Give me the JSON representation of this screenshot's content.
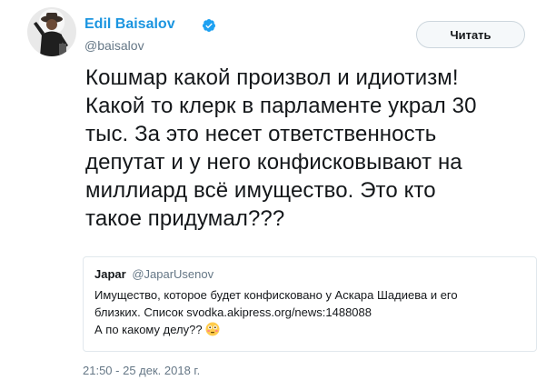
{
  "author": {
    "name": "Edil Baisalov",
    "handle": "@baisalov",
    "verified": true
  },
  "follow_button": {
    "label": "Читать"
  },
  "tweet": {
    "lines": [
      "Кошмар какой произвол и идиотизм!",
      "Какой то клерк в парламенте украл 30",
      "тыс. За это несет ответственность",
      "депутат и у него конфисковывают на",
      "миллиард всё имущество. Это кто",
      "такое придумал???"
    ]
  },
  "quoted_tweet": {
    "name": "Japar",
    "handle": "@JaparUsenov",
    "lines": [
      "Имущество, которое будет конфисковано у Аскара Шадиева и его",
      "близких. Список svodka.akipress.org/news:1488088",
      "А по какому делу??"
    ],
    "emoji_icon": "flushed-face-icon"
  },
  "timestamp": "21:50 - 25 дек. 2018 г.",
  "colors": {
    "link_blue": "#1b95e0",
    "muted_gray": "#657786",
    "border": "#e1e8ed"
  }
}
